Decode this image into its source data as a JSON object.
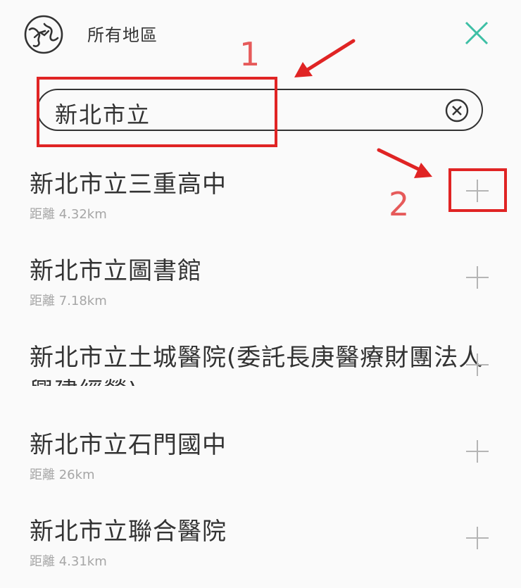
{
  "header": {
    "title": "所有地區",
    "globe_icon": "globe-icon",
    "close_icon": "close-icon"
  },
  "search": {
    "value": "新北市立",
    "clear_icon": "clear-circle-icon"
  },
  "annotations": {
    "step1": "1",
    "step2": "2",
    "color": "#e02424"
  },
  "results": [
    {
      "name": "新北市立三重高中",
      "distance": "距離 4.32km"
    },
    {
      "name": "新北市立圖書館",
      "distance": "距離 7.18km"
    },
    {
      "name": "新北市立土城醫院(委託長庚醫療財團法人",
      "name_line2": "興建經營)",
      "distance": ""
    },
    {
      "name": "新北市立石門國中",
      "distance": "距離 26km"
    },
    {
      "name": "新北市立聯合醫院",
      "distance": "距離 4.31km"
    }
  ],
  "colors": {
    "accent": "#3dbfa5",
    "text": "#333333",
    "muted": "#a6a6a6",
    "annotation": "#e02424"
  }
}
